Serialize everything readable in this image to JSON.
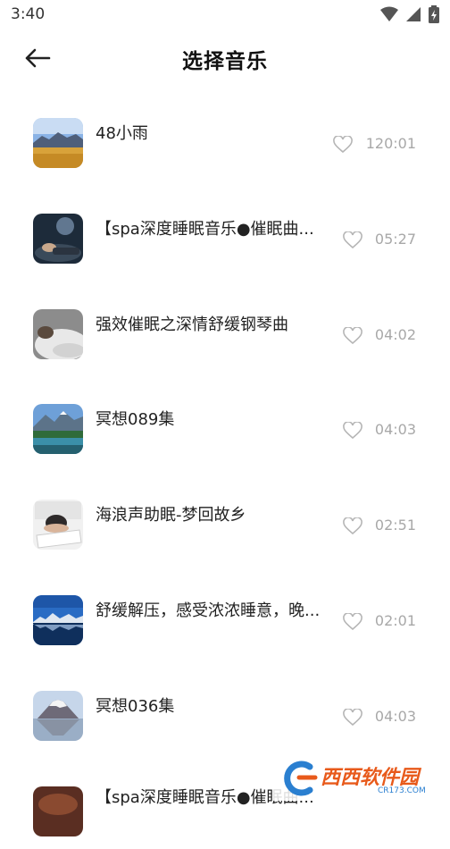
{
  "status_bar": {
    "time": "3:40"
  },
  "header": {
    "title": "选择音乐"
  },
  "tracks": [
    {
      "title": "48小雨",
      "duration": "120:01",
      "thumb": "landscape-mountain-plain"
    },
    {
      "title": "【spa深度睡眠音乐●催眠曲...",
      "duration": "05:27",
      "thumb": "sleeping-person-night"
    },
    {
      "title": "强效催眠之深情舒缓钢琴曲",
      "duration": "04:02",
      "thumb": "sleeping-in-blanket"
    },
    {
      "title": "冥想089集",
      "duration": "04:03",
      "thumb": "lake-mountains-forest"
    },
    {
      "title": "海浪声助眠-梦回故乡",
      "duration": "02:51",
      "thumb": "person-asleep-on-books"
    },
    {
      "title": "舒缓解压，感受浓浓睡意，晚...",
      "duration": "02:01",
      "thumb": "snow-mountain-lake"
    },
    {
      "title": "冥想036集",
      "duration": "04:03",
      "thumb": "volcano-reflection"
    },
    {
      "title": "【spa深度睡眠音乐●催眠曲...",
      "duration": "",
      "thumb": "sleeping-person-warm"
    }
  ],
  "watermark": {
    "brand": "西西软件园",
    "url": "CR173.COM"
  },
  "colors": {
    "accent_text": "#222222",
    "duration_text": "#a8a8a8",
    "heart_stroke": "#b5b5b5"
  }
}
